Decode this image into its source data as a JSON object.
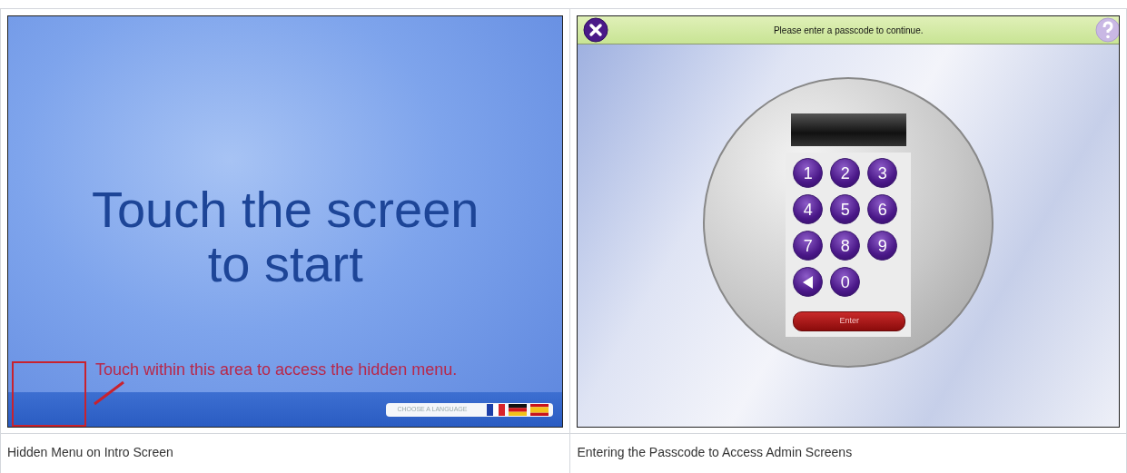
{
  "panels": [
    {
      "kind": "intro",
      "headline": "Touch the screen\nto start",
      "annotation": "Touch within this area to access the hidden menu.",
      "language_prompt": "CHOOSE A LANGUAGE",
      "caption": "Hidden Menu on Intro Screen"
    },
    {
      "kind": "passcode",
      "title": "Please enter a passcode to continue.",
      "keys": [
        {
          "kind": "digit",
          "label": "1"
        },
        {
          "kind": "digit",
          "label": "2"
        },
        {
          "kind": "digit",
          "label": "3"
        },
        {
          "kind": "digit",
          "label": "4"
        },
        {
          "kind": "digit",
          "label": "5"
        },
        {
          "kind": "digit",
          "label": "6"
        },
        {
          "kind": "digit",
          "label": "7"
        },
        {
          "kind": "digit",
          "label": "8"
        },
        {
          "kind": "digit",
          "label": "9"
        },
        {
          "kind": "back"
        },
        {
          "kind": "digit",
          "label": "0"
        }
      ],
      "enter_button": "Enter",
      "caption": "Entering the Passcode to Access Admin Screens"
    }
  ]
}
